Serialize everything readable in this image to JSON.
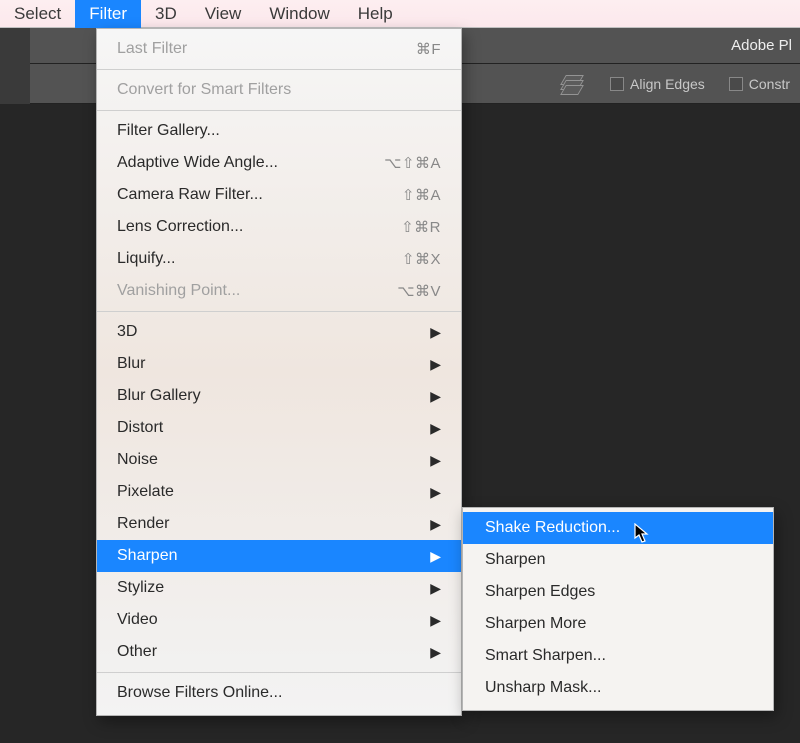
{
  "menubar": {
    "items": [
      {
        "label": "Select"
      },
      {
        "label": "Filter"
      },
      {
        "label": "3D"
      },
      {
        "label": "View"
      },
      {
        "label": "Window"
      },
      {
        "label": "Help"
      }
    ]
  },
  "app_title": "Adobe Pl",
  "options_bar": {
    "align_edges": "Align Edges",
    "constr": "Constr"
  },
  "filter_menu": {
    "groups": [
      [
        {
          "label": "Last Filter",
          "shortcut": "⌘F",
          "disabled": true
        }
      ],
      [
        {
          "label": "Convert for Smart Filters",
          "disabled": true
        }
      ],
      [
        {
          "label": "Filter Gallery..."
        },
        {
          "label": "Adaptive Wide Angle...",
          "shortcut": "⌥⇧⌘A"
        },
        {
          "label": "Camera Raw Filter...",
          "shortcut": "⇧⌘A"
        },
        {
          "label": "Lens Correction...",
          "shortcut": "⇧⌘R"
        },
        {
          "label": "Liquify...",
          "shortcut": "⇧⌘X"
        },
        {
          "label": "Vanishing Point...",
          "shortcut": "⌥⌘V",
          "disabled": true
        }
      ],
      [
        {
          "label": "3D",
          "submenu": true
        },
        {
          "label": "Blur",
          "submenu": true
        },
        {
          "label": "Blur Gallery",
          "submenu": true
        },
        {
          "label": "Distort",
          "submenu": true
        },
        {
          "label": "Noise",
          "submenu": true
        },
        {
          "label": "Pixelate",
          "submenu": true
        },
        {
          "label": "Render",
          "submenu": true
        },
        {
          "label": "Sharpen",
          "submenu": true,
          "selected": true
        },
        {
          "label": "Stylize",
          "submenu": true
        },
        {
          "label": "Video",
          "submenu": true
        },
        {
          "label": "Other",
          "submenu": true
        }
      ],
      [
        {
          "label": "Browse Filters Online..."
        }
      ]
    ]
  },
  "sharpen_submenu": {
    "items": [
      {
        "label": "Shake Reduction...",
        "selected": true
      },
      {
        "label": "Sharpen"
      },
      {
        "label": "Sharpen Edges"
      },
      {
        "label": "Sharpen More"
      },
      {
        "label": "Smart Sharpen..."
      },
      {
        "label": "Unsharp Mask..."
      }
    ]
  }
}
